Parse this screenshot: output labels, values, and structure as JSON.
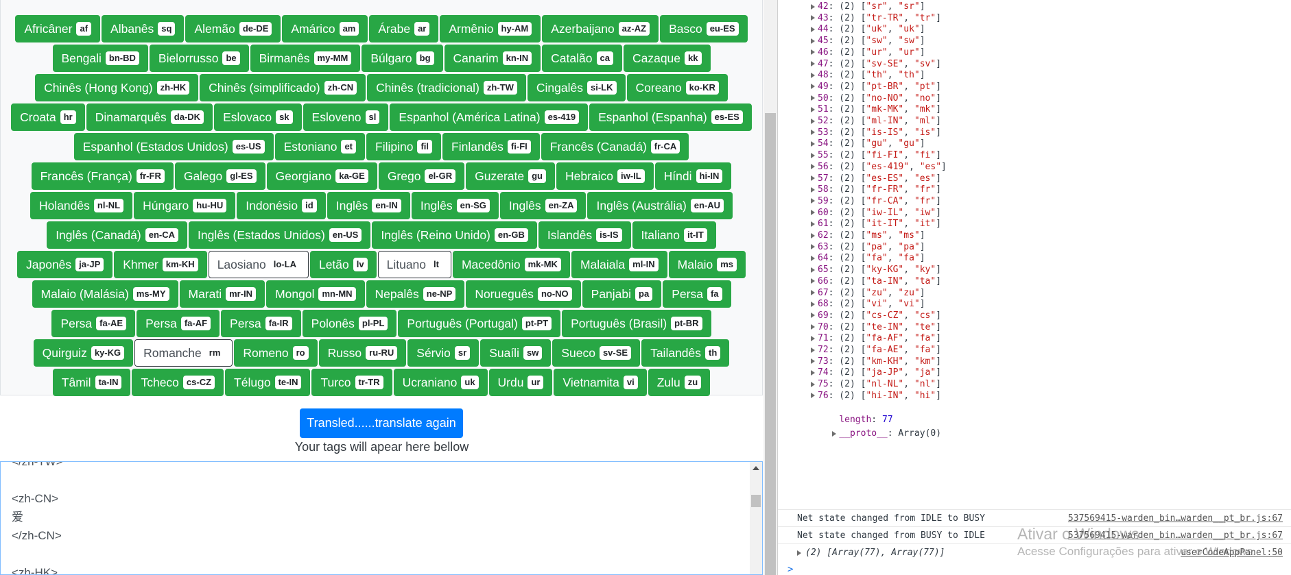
{
  "languages": [
    {
      "name": "Africâner",
      "code": "af"
    },
    {
      "name": "Albanês",
      "code": "sq"
    },
    {
      "name": "Alemão",
      "code": "de-DE"
    },
    {
      "name": "Amárico",
      "code": "am"
    },
    {
      "name": "Árabe",
      "code": "ar"
    },
    {
      "name": "Armênio",
      "code": "hy-AM"
    },
    {
      "name": "Azerbaijano",
      "code": "az-AZ"
    },
    {
      "name": "Basco",
      "code": "eu-ES"
    },
    {
      "name": "Bengali",
      "code": "bn-BD"
    },
    {
      "name": "Bielorrusso",
      "code": "be"
    },
    {
      "name": "Birmanês",
      "code": "my-MM"
    },
    {
      "name": "Búlgaro",
      "code": "bg"
    },
    {
      "name": "Canarim",
      "code": "kn-IN"
    },
    {
      "name": "Catalão",
      "code": "ca"
    },
    {
      "name": "Cazaque",
      "code": "kk"
    },
    {
      "name": "Chinês (Hong Kong)",
      "code": "zh-HK"
    },
    {
      "name": "Chinês (simplificado)",
      "code": "zh-CN"
    },
    {
      "name": "Chinês (tradicional)",
      "code": "zh-TW"
    },
    {
      "name": "Cingalês",
      "code": "si-LK"
    },
    {
      "name": "Coreano",
      "code": "ko-KR"
    },
    {
      "name": "Croata",
      "code": "hr"
    },
    {
      "name": "Dinamarquês",
      "code": "da-DK"
    },
    {
      "name": "Eslovaco",
      "code": "sk"
    },
    {
      "name": "Esloveno",
      "code": "sl"
    },
    {
      "name": "Espanhol (América Latina)",
      "code": "es-419"
    },
    {
      "name": "Espanhol (Espanha)",
      "code": "es-ES"
    },
    {
      "name": "Espanhol (Estados Unidos)",
      "code": "es-US"
    },
    {
      "name": "Estoniano",
      "code": "et"
    },
    {
      "name": "Filipino",
      "code": "fil"
    },
    {
      "name": "Finlandês",
      "code": "fi-FI"
    },
    {
      "name": "Francês (Canadá)",
      "code": "fr-CA"
    },
    {
      "name": "Francês (França)",
      "code": "fr-FR"
    },
    {
      "name": "Galego",
      "code": "gl-ES"
    },
    {
      "name": "Georgiano",
      "code": "ka-GE"
    },
    {
      "name": "Grego",
      "code": "el-GR"
    },
    {
      "name": "Guzerate",
      "code": "gu"
    },
    {
      "name": "Hebraico",
      "code": "iw-IL"
    },
    {
      "name": "Híndi",
      "code": "hi-IN"
    },
    {
      "name": "Holandês",
      "code": "nl-NL"
    },
    {
      "name": "Húngaro",
      "code": "hu-HU"
    },
    {
      "name": "Indonésio",
      "code": "id"
    },
    {
      "name": "Inglês",
      "code": "en-IN"
    },
    {
      "name": "Inglês",
      "code": "en-SG"
    },
    {
      "name": "Inglês",
      "code": "en-ZA"
    },
    {
      "name": "Inglês (Austrália)",
      "code": "en-AU"
    },
    {
      "name": "Inglês (Canadá)",
      "code": "en-CA"
    },
    {
      "name": "Inglês (Estados Unidos)",
      "code": "en-US"
    },
    {
      "name": "Inglês (Reino Unido)",
      "code": "en-GB"
    },
    {
      "name": "Islandês",
      "code": "is-IS"
    },
    {
      "name": "Italiano",
      "code": "it-IT"
    },
    {
      "name": "Japonês",
      "code": "ja-JP"
    },
    {
      "name": "Khmer",
      "code": "km-KH"
    },
    {
      "name": "Laosiano",
      "code": "lo-LA",
      "selected": false
    },
    {
      "name": "Letão",
      "code": "lv"
    },
    {
      "name": "Lituano",
      "code": "lt",
      "selected": false
    },
    {
      "name": "Macedônio",
      "code": "mk-MK"
    },
    {
      "name": "Malaiala",
      "code": "ml-IN"
    },
    {
      "name": "Malaio",
      "code": "ms"
    },
    {
      "name": "Malaio (Malásia)",
      "code": "ms-MY"
    },
    {
      "name": "Marati",
      "code": "mr-IN"
    },
    {
      "name": "Mongol",
      "code": "mn-MN"
    },
    {
      "name": "Nepalês",
      "code": "ne-NP"
    },
    {
      "name": "Norueguês",
      "code": "no-NO"
    },
    {
      "name": "Panjabi",
      "code": "pa"
    },
    {
      "name": "Persa",
      "code": "fa"
    },
    {
      "name": "Persa",
      "code": "fa-AE"
    },
    {
      "name": "Persa",
      "code": "fa-AF"
    },
    {
      "name": "Persa",
      "code": "fa-IR"
    },
    {
      "name": "Polonês",
      "code": "pl-PL"
    },
    {
      "name": "Português (Portugal)",
      "code": "pt-PT"
    },
    {
      "name": "Português (Brasil)",
      "code": "pt-BR"
    },
    {
      "name": "Quirguiz",
      "code": "ky-KG"
    },
    {
      "name": "Romanche",
      "code": "rm",
      "selected": false
    },
    {
      "name": "Romeno",
      "code": "ro"
    },
    {
      "name": "Russo",
      "code": "ru-RU"
    },
    {
      "name": "Sérvio",
      "code": "sr"
    },
    {
      "name": "Suaíli",
      "code": "sw"
    },
    {
      "name": "Sueco",
      "code": "sv-SE"
    },
    {
      "name": "Tailandês",
      "code": "th"
    },
    {
      "name": "Tâmil",
      "code": "ta-IN"
    },
    {
      "name": "Tcheco",
      "code": "cs-CZ"
    },
    {
      "name": "Télugo",
      "code": "te-IN"
    },
    {
      "name": "Turco",
      "code": "tr-TR"
    },
    {
      "name": "Ucraniano",
      "code": "uk"
    },
    {
      "name": "Urdu",
      "code": "ur"
    },
    {
      "name": "Vietnamita",
      "code": "vi"
    },
    {
      "name": "Zulu",
      "code": "zu"
    }
  ],
  "translate_button": "Transled......translate again",
  "hint": "Your tags will apear here bellow",
  "output_lines": [
    "</zh-TW>",
    "",
    "<zh-CN>",
    "爱",
    "</zh-CN>",
    "",
    "<zh-HK>"
  ],
  "console": {
    "array_rows": [
      {
        "idx": "42",
        "a": "sr",
        "b": "sr"
      },
      {
        "idx": "43",
        "a": "tr-TR",
        "b": "tr"
      },
      {
        "idx": "44",
        "a": "uk",
        "b": "uk"
      },
      {
        "idx": "45",
        "a": "sw",
        "b": "sw"
      },
      {
        "idx": "46",
        "a": "ur",
        "b": "ur"
      },
      {
        "idx": "47",
        "a": "sv-SE",
        "b": "sv"
      },
      {
        "idx": "48",
        "a": "th",
        "b": "th"
      },
      {
        "idx": "49",
        "a": "pt-BR",
        "b": "pt"
      },
      {
        "idx": "50",
        "a": "no-NO",
        "b": "no"
      },
      {
        "idx": "51",
        "a": "mk-MK",
        "b": "mk"
      },
      {
        "idx": "52",
        "a": "ml-IN",
        "b": "ml"
      },
      {
        "idx": "53",
        "a": "is-IS",
        "b": "is"
      },
      {
        "idx": "54",
        "a": "gu",
        "b": "gu"
      },
      {
        "idx": "55",
        "a": "fi-FI",
        "b": "fi"
      },
      {
        "idx": "56",
        "a": "es-419",
        "b": "es"
      },
      {
        "idx": "57",
        "a": "es-ES",
        "b": "es"
      },
      {
        "idx": "58",
        "a": "fr-FR",
        "b": "fr"
      },
      {
        "idx": "59",
        "a": "fr-CA",
        "b": "fr"
      },
      {
        "idx": "60",
        "a": "iw-IL",
        "b": "iw"
      },
      {
        "idx": "61",
        "a": "it-IT",
        "b": "it"
      },
      {
        "idx": "62",
        "a": "ms",
        "b": "ms"
      },
      {
        "idx": "63",
        "a": "pa",
        "b": "pa"
      },
      {
        "idx": "64",
        "a": "fa",
        "b": "fa"
      },
      {
        "idx": "65",
        "a": "ky-KG",
        "b": "ky"
      },
      {
        "idx": "66",
        "a": "ta-IN",
        "b": "ta"
      },
      {
        "idx": "67",
        "a": "zu",
        "b": "zu"
      },
      {
        "idx": "68",
        "a": "vi",
        "b": "vi"
      },
      {
        "idx": "69",
        "a": "cs-CZ",
        "b": "cs"
      },
      {
        "idx": "70",
        "a": "te-IN",
        "b": "te"
      },
      {
        "idx": "71",
        "a": "fa-AF",
        "b": "fa"
      },
      {
        "idx": "72",
        "a": "fa-AE",
        "b": "fa"
      },
      {
        "idx": "73",
        "a": "km-KH",
        "b": "km"
      },
      {
        "idx": "74",
        "a": "ja-JP",
        "b": "ja"
      },
      {
        "idx": "75",
        "a": "nl-NL",
        "b": "nl"
      },
      {
        "idx": "76",
        "a": "hi-IN",
        "b": "hi"
      }
    ],
    "length_label": "length",
    "length_value": "77",
    "proto_label": "__proto__",
    "proto_value": "Array(0)",
    "logs": [
      {
        "msg": "Net state changed from IDLE to BUSY",
        "src": "537569415-warden_bin…warden__pt_br.js:67"
      },
      {
        "msg": "Net state changed from BUSY to IDLE",
        "src": "537569415-warden_bin…warden__pt_br.js:67"
      }
    ],
    "summary": {
      "msg": "(2) [Array(77), Array(77)]",
      "src": "userCodeAppPanel:50"
    },
    "prompt": ">"
  },
  "watermark": {
    "line1": "Ativar o Windows",
    "line2": "Acesse Configurações para ativar o Windows."
  },
  "colors": {
    "lang_button_bg": "#28a745",
    "primary_button_bg": "#007bff",
    "console_index": "#881280",
    "console_string": "#c41a16",
    "console_number": "#1c00cf"
  }
}
